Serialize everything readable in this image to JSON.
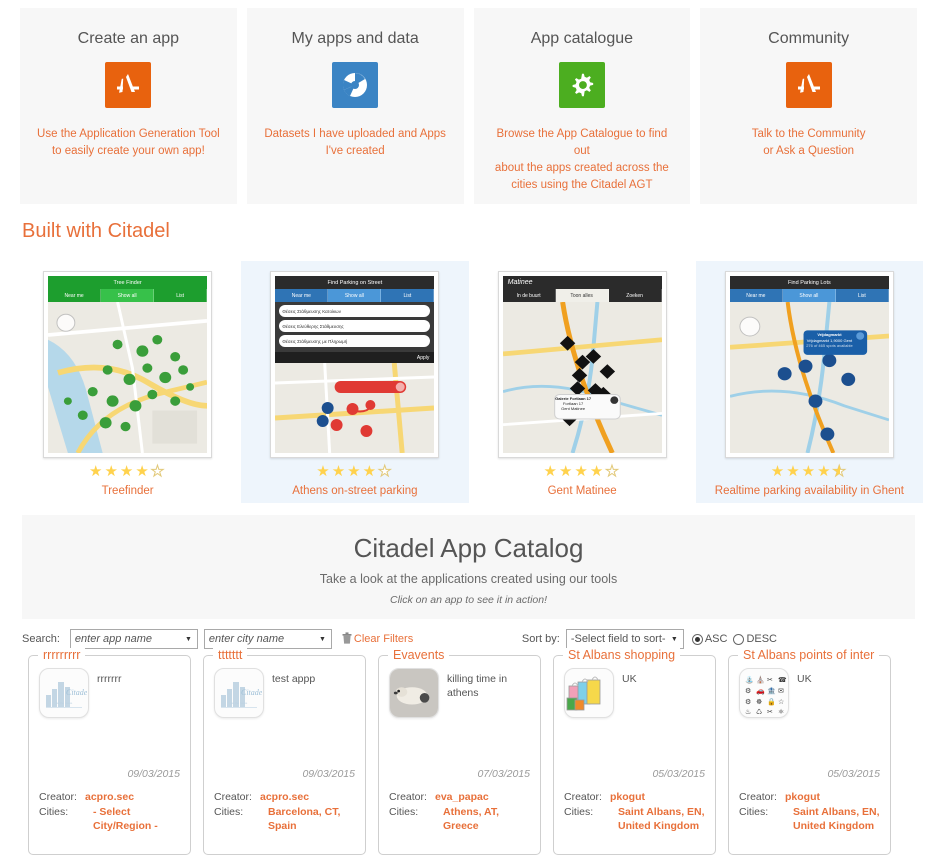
{
  "colors": {
    "accent_orange": "#e8703a",
    "icon_orange": "#e8620e",
    "icon_blue": "#3b84c4",
    "icon_green": "#4cae20",
    "panel_grey": "#f7f7f7",
    "highlight_blue": "#eef5fc",
    "star_gold": "#ffd24d"
  },
  "promo_cards": [
    {
      "title": "Create an app",
      "icon": "appstore-icon",
      "icon_color": "#e8620e",
      "desc_line1": "Use the Application Generation Tool",
      "desc_line2": "to easily create your own app!"
    },
    {
      "title": "My apps and data",
      "icon": "aperture-icon",
      "icon_color": "#3b84c4",
      "desc_line1": "Datasets I have uploaded and Apps",
      "desc_line2": "I've created"
    },
    {
      "title": "App catalogue",
      "icon": "gear-icon",
      "icon_color": "#4cae20",
      "desc_line1": "Browse the App Catalogue to find out",
      "desc_line2": "about the apps created across the",
      "desc_line3": "cities using the Citadel AGT"
    },
    {
      "title": "Community",
      "icon": "appstore-icon",
      "icon_color": "#e8620e",
      "desc_line1": "Talk to the Community",
      "desc_line2": "or Ask a Question"
    }
  ],
  "built_with": {
    "heading": "Built with Citadel",
    "apps": [
      {
        "name": "Treefinder",
        "rating": 4,
        "highlighted": false,
        "screen_title": "Tree Finder",
        "tabs": [
          "Near me",
          "Show all",
          "List"
        ],
        "selected_tab": 1,
        "theme": "green"
      },
      {
        "name": "Athens on-street parking",
        "rating": 4,
        "highlighted": true,
        "screen_title": "Find Parking on Street",
        "tabs": [
          "Near me",
          "Show all",
          "List"
        ],
        "selected_tab": 1,
        "theme": "blue",
        "list_items": [
          "Θέσεις Στάθμευσης Κατοίκων",
          "Θέσεις Ελεύθερης Στάθμευσης",
          "Θέσεις Στάθμευσης με Πληρωμή"
        ],
        "apply_label": "Apply"
      },
      {
        "name": "Gent Matinee",
        "rating": 4,
        "highlighted": false,
        "screen_title": "Matinee",
        "tabs": [
          "In de buurt",
          "Toon alles",
          "Zoeken"
        ],
        "selected_tab": 1,
        "theme": "dark",
        "popup_title": "Galerie Fortlaan 17",
        "popup_line1": "Fortlaan 17",
        "popup_line2": "Gent Matinee"
      },
      {
        "name": "Realtime parking availability in Ghent",
        "rating": 4.5,
        "highlighted": true,
        "screen_title": "Find Parking Lots",
        "tabs": [
          "Near me",
          "Show all",
          "List"
        ],
        "selected_tab": 1,
        "theme": "blue",
        "popup_title": "Vrijdagmarkt",
        "popup_line1": "Vrijdagmarkt 1,9000 Gent",
        "popup_line2": "276 of 465 spots available"
      }
    ]
  },
  "catalog_banner": {
    "title": "Citadel App Catalog",
    "subtitle": "Take a look at the applications created using our tools",
    "note": "Click on an app to see it in action!"
  },
  "filters": {
    "search_label": "Search:",
    "app_name_placeholder": "enter app name",
    "city_name_placeholder": "enter city name",
    "clear_filters_label": "Clear Filters",
    "sort_by_label": "Sort by:",
    "sort_field_value": "-Select field to sort-",
    "asc_label": "ASC",
    "desc_label": "DESC",
    "sort_direction": "ASC"
  },
  "catalog_cards": [
    {
      "legend": "rrrrrrrrr",
      "description": "rrrrrrr",
      "thumb": "citadel-logo-icon",
      "date": "09/03/2015",
      "creator_label": "Creator:",
      "creator": "acpro.sec",
      "cities_label": "Cities:",
      "cities_line1": "- Select City/Region -",
      "cities_line2": ""
    },
    {
      "legend": "ttttttt",
      "description": "test appp",
      "thumb": "citadel-logo-icon",
      "date": "09/03/2015",
      "creator_label": "Creator:",
      "creator": "acpro.sec",
      "cities_label": "Cities:",
      "cities_line1": "Barcelona, CT, Spain",
      "cities_line2": ""
    },
    {
      "legend": "Evavents",
      "description": "killing time in athens",
      "thumb": "dog-photo-icon",
      "date": "07/03/2015",
      "creator_label": "Creator:",
      "creator": "eva_papac",
      "cities_label": "Cities:",
      "cities_line1": "Athens, AT, Greece",
      "cities_line2": ""
    },
    {
      "legend": "St Albans shopping",
      "description": "UK",
      "thumb": "shopping-bags-icon",
      "date": "05/03/2015",
      "creator_label": "Creator:",
      "creator": "pkogut",
      "cities_label": "Cities:",
      "cities_line1": "Saint Albans, EN,",
      "cities_line2": "United Kingdom"
    },
    {
      "legend": "St Albans points of inter",
      "description": "UK",
      "thumb": "poi-grid-icon",
      "date": "05/03/2015",
      "creator_label": "Creator:",
      "creator": "pkogut",
      "cities_label": "Cities:",
      "cities_line1": "Saint Albans, EN,",
      "cities_line2": "United Kingdom"
    }
  ]
}
